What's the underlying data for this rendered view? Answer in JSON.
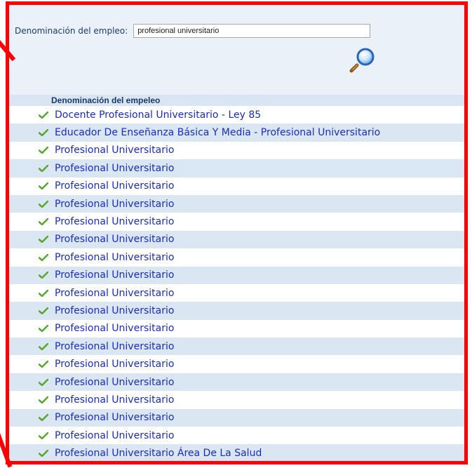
{
  "search": {
    "label": "Denominación del empleo:",
    "value": "profesional universitario"
  },
  "list": {
    "header": "Denominación del empeleo",
    "items": [
      {
        "label": "Docente Profesional Universitario - Ley 85"
      },
      {
        "label": "Educador De Enseñanza Básica Y Media - Profesional Universitario"
      },
      {
        "label": "Profesional Universitario"
      },
      {
        "label": "Profesional Universitario"
      },
      {
        "label": "Profesional Universitario"
      },
      {
        "label": "Profesional Universitario"
      },
      {
        "label": "Profesional Universitario"
      },
      {
        "label": "Profesional Universitario"
      },
      {
        "label": "Profesional Universitario"
      },
      {
        "label": "Profesional Universitario"
      },
      {
        "label": "Profesional Universitario"
      },
      {
        "label": "Profesional Universitario"
      },
      {
        "label": "Profesional Universitario"
      },
      {
        "label": "Profesional Universitario"
      },
      {
        "label": "Profesional Universitario"
      },
      {
        "label": "Profesional Universitario"
      },
      {
        "label": "Profesional Universitario"
      },
      {
        "label": "Profesional Universitario"
      },
      {
        "label": "Profesional Universitario"
      },
      {
        "label": "Profesional Universitario Área De La Salud"
      }
    ]
  },
  "icons": {
    "search_button": "magnifier-icon",
    "row_icon": "check-icon"
  },
  "colors": {
    "annotation": "#ff0000",
    "link": "#1a2bcc",
    "row_alt": "#dae6f2",
    "check": "#5aa832"
  }
}
